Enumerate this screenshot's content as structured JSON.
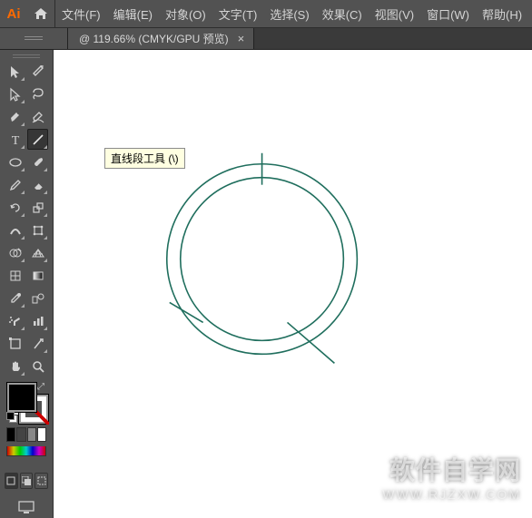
{
  "app": {
    "logo_text": "Ai"
  },
  "menu": {
    "file": "文件(F)",
    "edit": "编辑(E)",
    "object": "对象(O)",
    "type": "文字(T)",
    "select": "选择(S)",
    "effect": "效果(C)",
    "view": "视图(V)",
    "window": "窗口(W)",
    "help": "帮助(H)"
  },
  "document_tab": {
    "label": "@ 119.66% (CMYK/GPU 预览)",
    "close_glyph": "×"
  },
  "tooltip": {
    "line_tool": "直线段工具 (\\)"
  },
  "tools": {
    "selection": "selection",
    "magic_wand": "magic-wand",
    "direct_selection": "direct-selection",
    "lasso": "lasso",
    "pen": "pen",
    "curvature_pen": "curvature-pen",
    "type": "type",
    "line": "line",
    "ellipse": "ellipse",
    "paintbrush": "paintbrush",
    "pencil": "pencil",
    "eraser": "eraser",
    "rotate": "rotate",
    "scale": "scale",
    "width": "width",
    "free_transform": "free-transform",
    "shape_builder": "shape-builder",
    "perspective": "perspective",
    "mesh": "mesh",
    "gradient": "gradient",
    "eyedropper": "eyedropper",
    "blend": "blend",
    "symbol_sprayer": "symbol-sprayer",
    "column_graph": "column-graph",
    "artboard": "artboard",
    "slice": "slice",
    "hand": "hand",
    "zoom": "zoom"
  },
  "colors": {
    "fill": "#000000",
    "stroke": "none",
    "artwork_stroke": "#1f6e5d"
  },
  "view": {
    "zoom_percent": 119.66,
    "color_mode": "CMYK",
    "gpu": true
  },
  "watermark": {
    "line1": "软件自学网",
    "line2": "WWW.RJZXW.COM"
  }
}
